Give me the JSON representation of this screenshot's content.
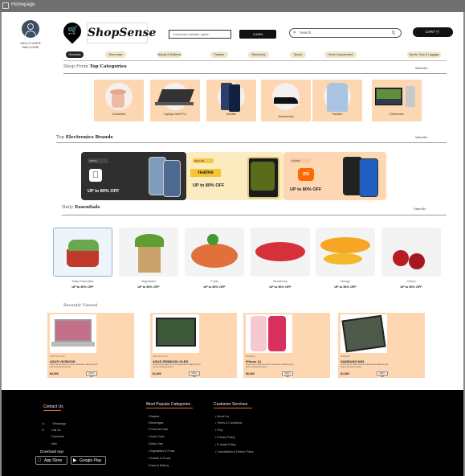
{
  "window": {
    "title": "Homepage"
  },
  "user": {
    "label_line1": "HELLO USER",
    "label_line2": "WELCOME"
  },
  "header": {
    "brand_name": "ShopSense",
    "help_placeholder": "Customize website option",
    "login_label": "LOGIN",
    "search_placeholder": "Search",
    "cart_label": "CART"
  },
  "nav": {
    "items": [
      "Groceries",
      "Mens wear",
      "Beauty & Wellness",
      "Fashion",
      "Electronics",
      "Sports",
      "Home Improvement",
      "Sports, Toys & Luggage"
    ]
  },
  "categories": {
    "title_prefix": "Shop From",
    "title_bold": "Top Categories",
    "view_all": "View All",
    "items": [
      "Cosmetics",
      "Laptops and PCs",
      "Mobiles",
      "Accessories",
      "Fashion",
      "Electronics"
    ]
  },
  "brands": {
    "title_prefix": "Top",
    "title_bold": "Electronics Brands",
    "view_all": "View All",
    "items": [
      {
        "tag": "APPLE",
        "offer": "UP to 80% OFF",
        "logo": "apple-logo"
      },
      {
        "tag": "REALME",
        "brand_word": "realme",
        "offer": "UP to 80% OFF"
      },
      {
        "tag": "XIAOMI",
        "brand_word": "mi",
        "offer": "UP to 80% OFF"
      }
    ]
  },
  "essentials": {
    "title_prefix": "Daily",
    "title_bold": "Essentials",
    "view_all": "View All",
    "items": [
      {
        "name": "Daily Essentials",
        "offer": "UP to 50% OFF"
      },
      {
        "name": "Vegetables",
        "offer": "UP to 50% OFF"
      },
      {
        "name": "Fruits",
        "offer": "UP to 50% OFF"
      },
      {
        "name": "Strawberry",
        "offer": "UP to 50% OFF"
      },
      {
        "name": "Mango",
        "offer": "UP to 50% OFF"
      },
      {
        "name": "Cherry",
        "offer": "UP to 50% OFF"
      }
    ]
  },
  "recently_viewed": {
    "title": "Recently Viewed",
    "items": [
      {
        "sub": "LAPTOP & PCS",
        "name": "ASUS VIVIBOOK",
        "desc": "Lorem ipsum dolor sit amet consectetur adipiscing elit sed do eiusmod tempor",
        "price": "$0,000",
        "button": "Add to cart"
      },
      {
        "sub": "LAPTOP & PCS",
        "name": "ASUS ZENBOOK OLED",
        "desc": "Lorem ipsum dolor sit amet consectetur adipiscing elit sed do eiusmod tempor",
        "price": "$1,000",
        "button": "Add to cart"
      },
      {
        "sub": "MOBILES",
        "name": "iPhone 14",
        "desc": "Lorem ipsum dolor sit amet consectetur adipiscing elit sed do eiusmod tempor",
        "price": "$0,000",
        "button": "Add to cart"
      },
      {
        "sub": "MOBILES",
        "name": "SAMSUNG M33",
        "desc": "Lorem ipsum dolor sit amet consectetur adipiscing elit sed do eiusmod tempor",
        "price": "$1,000",
        "button": "Add to cart"
      }
    ]
  },
  "footer": {
    "contact_title": "Contact Us",
    "contact_links": [
      "WhatsApp",
      "Call Us",
      "Facebook",
      "Mail"
    ],
    "download_title": "Download App",
    "app_store": "App Store",
    "google_play": "Google Play",
    "popular_title": "Most Popular Categories",
    "popular_links": [
      "Staples",
      "Beverages",
      "Personal Care",
      "Home Care",
      "Baby Care",
      "Vegetables & Fruits",
      "Snacks & Foods",
      "Dairy & Bakery"
    ],
    "service_title": "Customer Services",
    "service_links": [
      "About Us",
      "Terms & Conditions",
      "FAQ",
      "Privacy Policy",
      "E-waste Policy",
      "Cancellation & Return Policy"
    ]
  },
  "colors": {
    "peach": "#fdd6b2",
    "pill": "#efe6c9",
    "accent": "#e26d2a",
    "footer_bg": "#000000"
  }
}
